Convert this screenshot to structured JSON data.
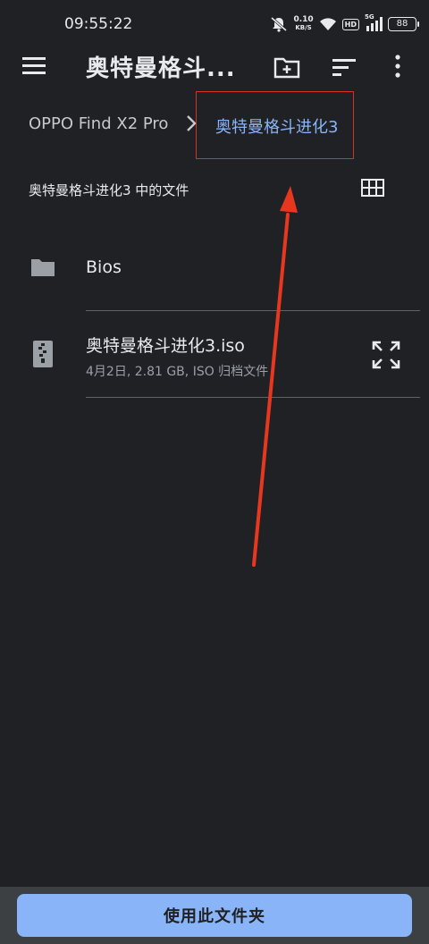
{
  "status_bar": {
    "time": "09:55:22",
    "speed_value": "0.10",
    "speed_unit": "KB/S",
    "hd_label": "HD",
    "network_label": "5G",
    "battery": "88"
  },
  "toolbar": {
    "title": "奥特曼格斗...",
    "icons": [
      "menu-icon",
      "new-folder-icon",
      "sort-icon",
      "more-vert-icon"
    ]
  },
  "breadcrumb": {
    "root": "OPPO Find X2 Pro",
    "current": "奥特曼格斗进化3"
  },
  "section": {
    "title": "奥特曼格斗进化3 中的文件"
  },
  "files": [
    {
      "name": "Bios",
      "type_icon": "folder-icon"
    },
    {
      "name": "奥特曼格斗进化3.iso",
      "meta": "4月2日, 2.81 GB, ISO 归档文件",
      "type_icon": "zip-icon"
    }
  ],
  "bottom": {
    "button_label": "使用此文件夹"
  },
  "colors": {
    "background": "#202124",
    "accent": "#8ab4f8",
    "annotation": "#d93025"
  }
}
